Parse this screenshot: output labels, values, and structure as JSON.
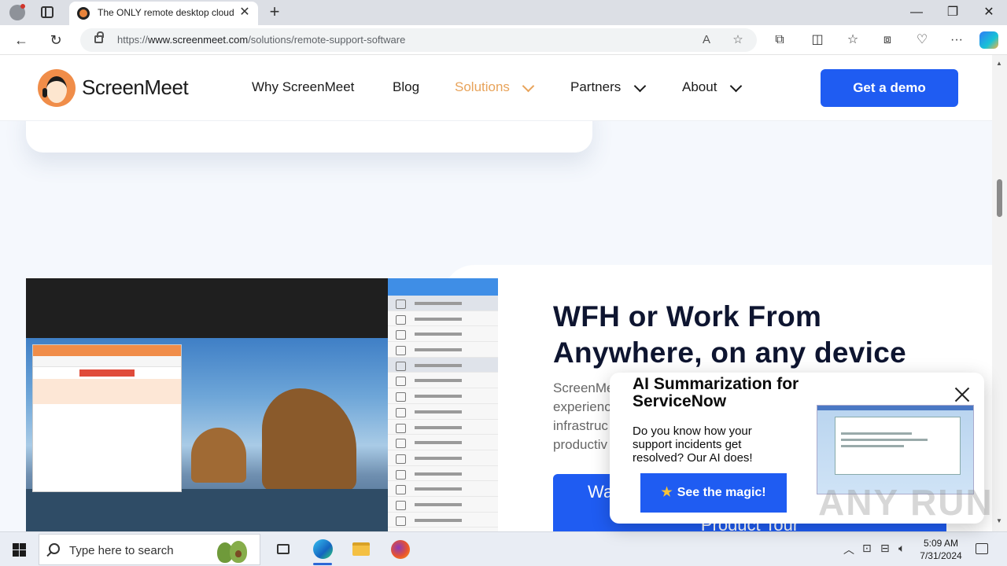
{
  "browser": {
    "tab_title": "The ONLY remote desktop cloud",
    "tab_close": "✕",
    "new_tab": "+",
    "url_prefix": "https://",
    "url_domain": "www.screenmeet.com",
    "url_path": "/solutions/remote-support-software",
    "window_minimize": "—",
    "window_restore": "❐",
    "window_close": "✕"
  },
  "site": {
    "logo_text": "ScreenMeet",
    "nav": [
      {
        "label": "Why ScreenMeet"
      },
      {
        "label": "Blog"
      },
      {
        "label": "Solutions"
      },
      {
        "label": "Partners"
      },
      {
        "label": "About"
      }
    ],
    "demo_button": "Get a demo"
  },
  "feature": {
    "title": "WFH or Work From Anywhere, on any device",
    "desc_lines": [
      "ScreenMe",
      "experienc",
      "infrastruc",
      "productiv"
    ],
    "cta_line1": "Wa",
    "cta_line2": "Product Tour"
  },
  "popup": {
    "title": "AI Summarization for ServiceNow",
    "text": "Do you know how your support incidents get resolved? Our AI does!",
    "button": "See the magic!"
  },
  "watermark": "ANY RUN",
  "taskbar": {
    "search_placeholder": "Type here to search",
    "time": "5:09 AM",
    "date": "7/31/2024"
  },
  "colors": {
    "brand_blue": "#1f5cf2",
    "brand_orange": "#f08d49",
    "active_nav": "#e8a35a"
  }
}
